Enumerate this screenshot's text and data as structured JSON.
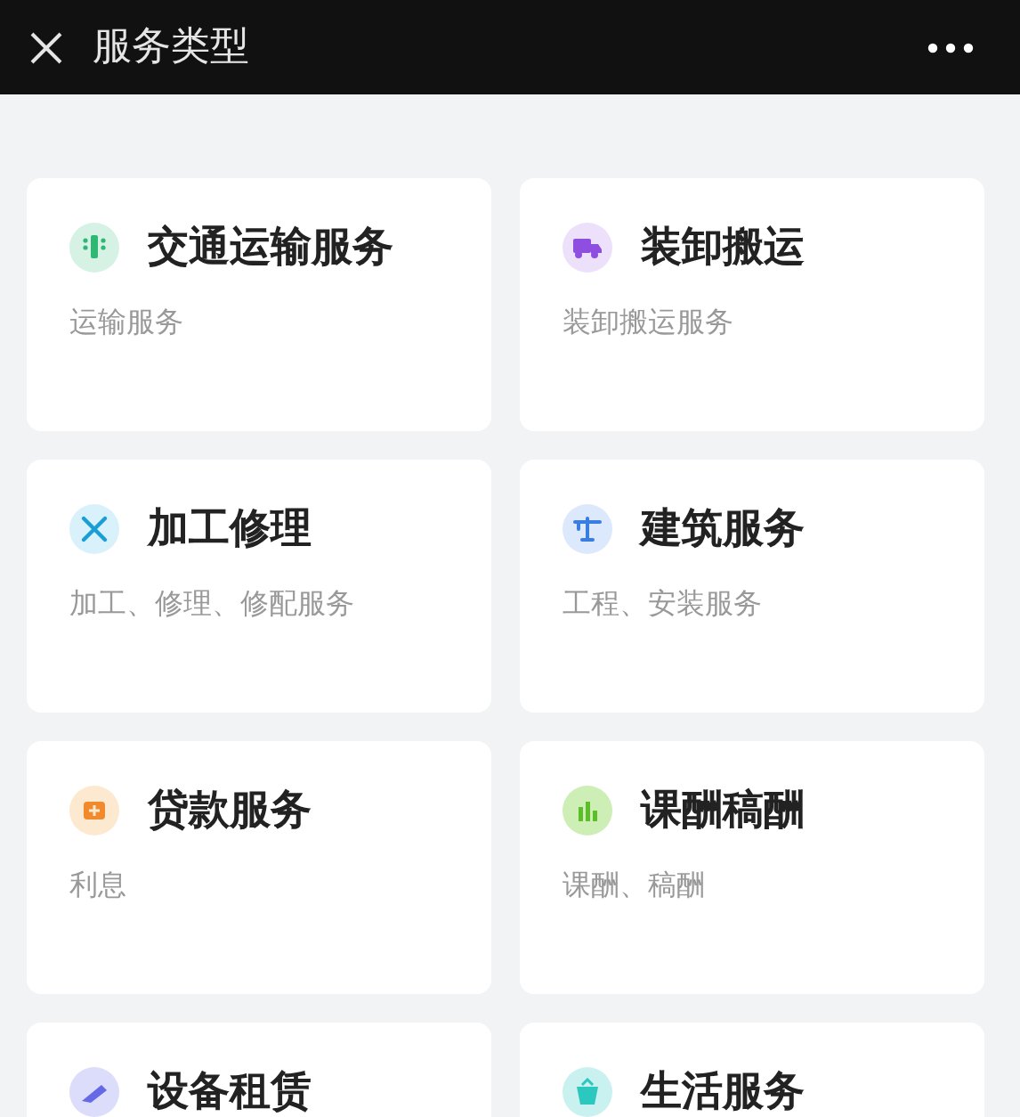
{
  "header": {
    "title": "服务类型"
  },
  "services": [
    {
      "kind": "traffic",
      "color": "#d6f2e4",
      "title": "交通运输服务",
      "subtitle": "运输服务"
    },
    {
      "kind": "truck",
      "color": "#ece0fb",
      "title": "装卸搬运",
      "subtitle": "装卸搬运服务"
    },
    {
      "kind": "tools",
      "color": "#d9f1fa",
      "title": "加工修理",
      "subtitle": "加工、修理、修配服务"
    },
    {
      "kind": "crane",
      "color": "#dce8fb",
      "title": "建筑服务",
      "subtitle": "工程、安装服务"
    },
    {
      "kind": "money",
      "color": "#fde9cf",
      "title": "贷款服务",
      "subtitle": "利息"
    },
    {
      "kind": "bars",
      "color": "#cdeeb4",
      "title": "课酬稿酬",
      "subtitle": "课酬、稿酬"
    },
    {
      "kind": "drill",
      "color": "#dcdcfb",
      "title": "设备租赁"
    },
    {
      "kind": "basket",
      "color": "#c9f1ef",
      "title": "生活服务"
    }
  ]
}
